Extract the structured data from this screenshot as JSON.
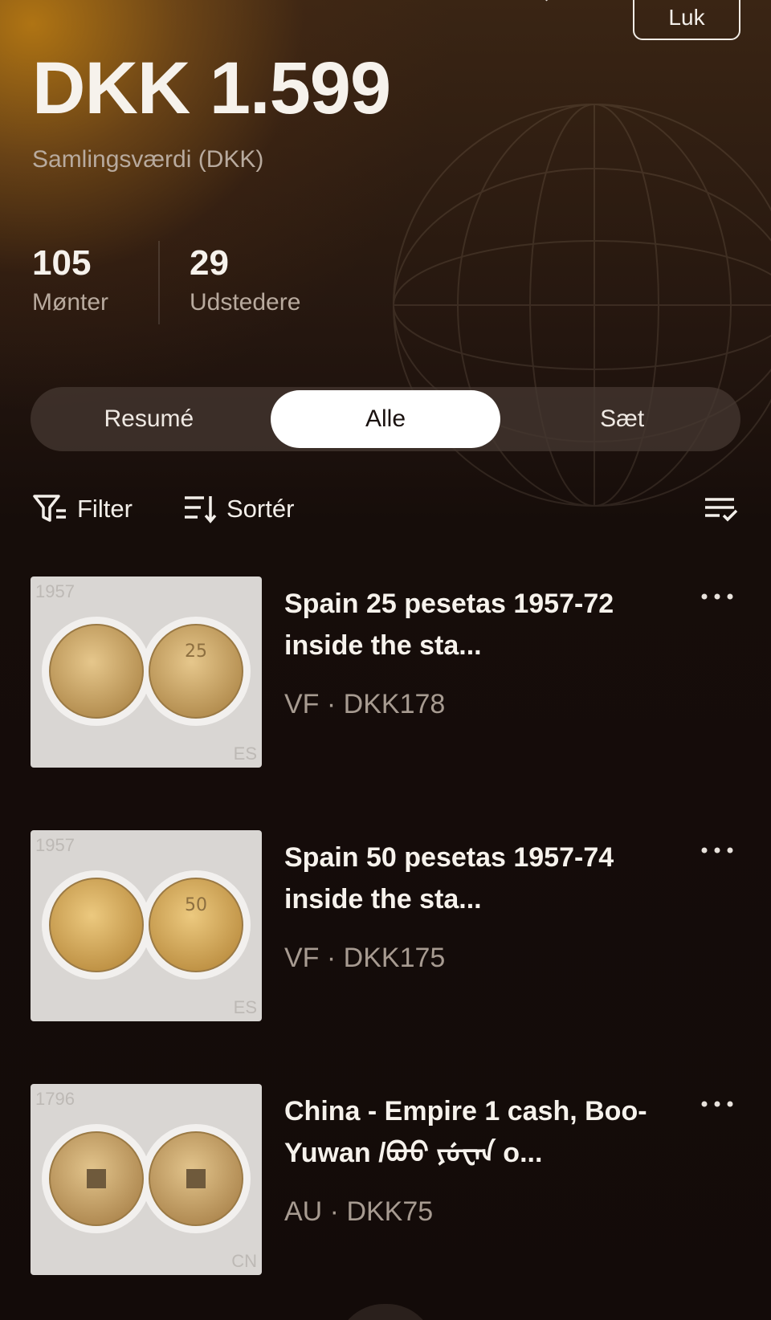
{
  "header": {
    "close_label": "Luk",
    "collection_value": "DKK 1.599",
    "collection_value_label": "Samlingsværdi (DKK)"
  },
  "stats": [
    {
      "value": "105",
      "label": "Mønter"
    },
    {
      "value": "29",
      "label": "Udstedere"
    }
  ],
  "tabs": [
    {
      "label": "Resumé",
      "active": false
    },
    {
      "label": "Alle",
      "active": true
    },
    {
      "label": "Sæt",
      "active": false
    }
  ],
  "toolbar": {
    "filter_label": "Filter",
    "sort_label": "Sortér"
  },
  "coins": [
    {
      "title": "Spain 25 pesetas 1957-72 inside the sta...",
      "meta": "VF · DKK178",
      "year": "1957",
      "country_code": "ES"
    },
    {
      "title": "Spain 50 pesetas 1957-74 inside the sta...",
      "meta": "VF · DKK175",
      "year": "1957",
      "country_code": "ES"
    },
    {
      "title": "China - Empire 1 cash, Boo-Yuwan /ᠪᠣᠣ ᠶᡠᠸᠠᠨ o...",
      "meta": "AU · DKK75",
      "year": "1796",
      "country_code": "CN"
    }
  ],
  "colors": {
    "accent_gold": "#c4821a",
    "background": "#140c09",
    "active_tab": "#ffffff"
  }
}
